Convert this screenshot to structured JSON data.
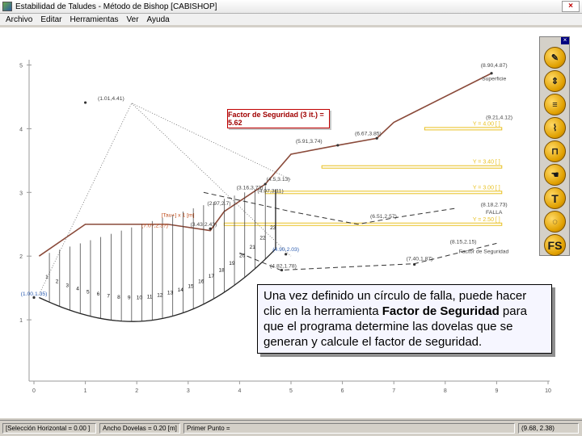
{
  "window": {
    "title": "Estabilidad de Taludes - Método de Bishop [CABISHOP]",
    "close_symbol": "×"
  },
  "menu": [
    "Archivo",
    "Editar",
    "Herramientas",
    "Ver",
    "Ayuda"
  ],
  "plot": {
    "x_ticks": [
      "0",
      "1",
      "2",
      "3",
      "4",
      "5",
      "6",
      "7",
      "8",
      "9",
      "10"
    ],
    "y_ticks": [
      "1",
      "2",
      "3",
      "4",
      "5"
    ],
    "surface_label": "Superficie",
    "surface_coord": "(8.90,4.87)",
    "point_labels": [
      {
        "text": "(1.01,4.41)",
        "color": "#444444"
      },
      {
        "text": "(5.91,3.74)",
        "color": "#444444"
      },
      {
        "text": "(6.67,3.85)",
        "color": "#444444"
      },
      {
        "text": "(9.21,4.12)",
        "color": "#444444"
      },
      {
        "text": "(4.5,3.13)",
        "color": "#444444"
      },
      {
        "text": "(4.07,3.11)",
        "color": "#444444"
      },
      {
        "text": "(3.16,3.73)",
        "color": "#444444"
      },
      {
        "text": "(2.97,2.7)",
        "color": "#444444"
      },
      {
        "text": "(3.43,2.43)",
        "color": "#444444"
      },
      {
        "text": "(6.51,2.57)",
        "color": "#444444"
      },
      {
        "text": "(8.18,2.73)",
        "color": "#444444"
      },
      {
        "text": "(4.90,2.03)",
        "color": "#2b5cb0"
      },
      {
        "text": "(4.82,1.78)",
        "color": "#444444"
      },
      {
        "text": "(7.40,1.87)",
        "color": "#444444"
      },
      {
        "text": "(8.15,2.15)",
        "color": "#444444"
      },
      {
        "text": "(1.00,1.35)",
        "color": "#2b5cb0"
      },
      {
        "text": "(7.0?,2.3?)",
        "color": "#c05020"
      }
    ],
    "falla_label": "FALLA",
    "factor_label": "Factor de Seguridad",
    "tau_label": "[Tau+] x 1 [m]",
    "water_levels": [
      {
        "text": "Y = 4.00 [ ]"
      },
      {
        "text": "Y = 3.40 [ ]"
      },
      {
        "text": "Y = 3.00 [ ]"
      },
      {
        "text": "Y = 2.50 [ ]"
      }
    ],
    "slice_numbers": [
      "1",
      "2",
      "3",
      "4",
      "5",
      "6",
      "7",
      "8",
      "9",
      "10",
      "11",
      "12",
      "13",
      "14",
      "15",
      "16",
      "17",
      "18",
      "19",
      "20",
      "21",
      "22",
      "23"
    ]
  },
  "factor_box": "Factor de Seguridad (3 it.) = 5.62",
  "toolbar": {
    "close": "×",
    "tools": [
      {
        "name": "pencil-tool",
        "label": "✎"
      },
      {
        "name": "measure-tool",
        "label": "⇕"
      },
      {
        "name": "layers-tool",
        "label": "≡"
      },
      {
        "name": "water-tool",
        "label": "⌇"
      },
      {
        "name": "dovela-tool",
        "label": "⊓"
      },
      {
        "name": "hand-tool",
        "label": "☚"
      },
      {
        "name": "text-tool",
        "label": "T"
      },
      {
        "name": "circle-tool",
        "label": "◌"
      },
      {
        "name": "factor-tool",
        "label": "FS"
      }
    ]
  },
  "callout": {
    "pre": "Una vez definido un círculo de falla, puede hacer clic en la herramienta ",
    "bold": "Factor de Seguridad",
    "post": " para que el programa determine las dovelas que se generan y calcule el factor de seguridad."
  },
  "status": {
    "cell1": "[Selección Horizontal = 0.00 ]",
    "cell2": "Ancho Dovelas = 0.20 [m]",
    "cell3": "Primer Punto = ",
    "cell4": "(9.68, 2.38)"
  }
}
